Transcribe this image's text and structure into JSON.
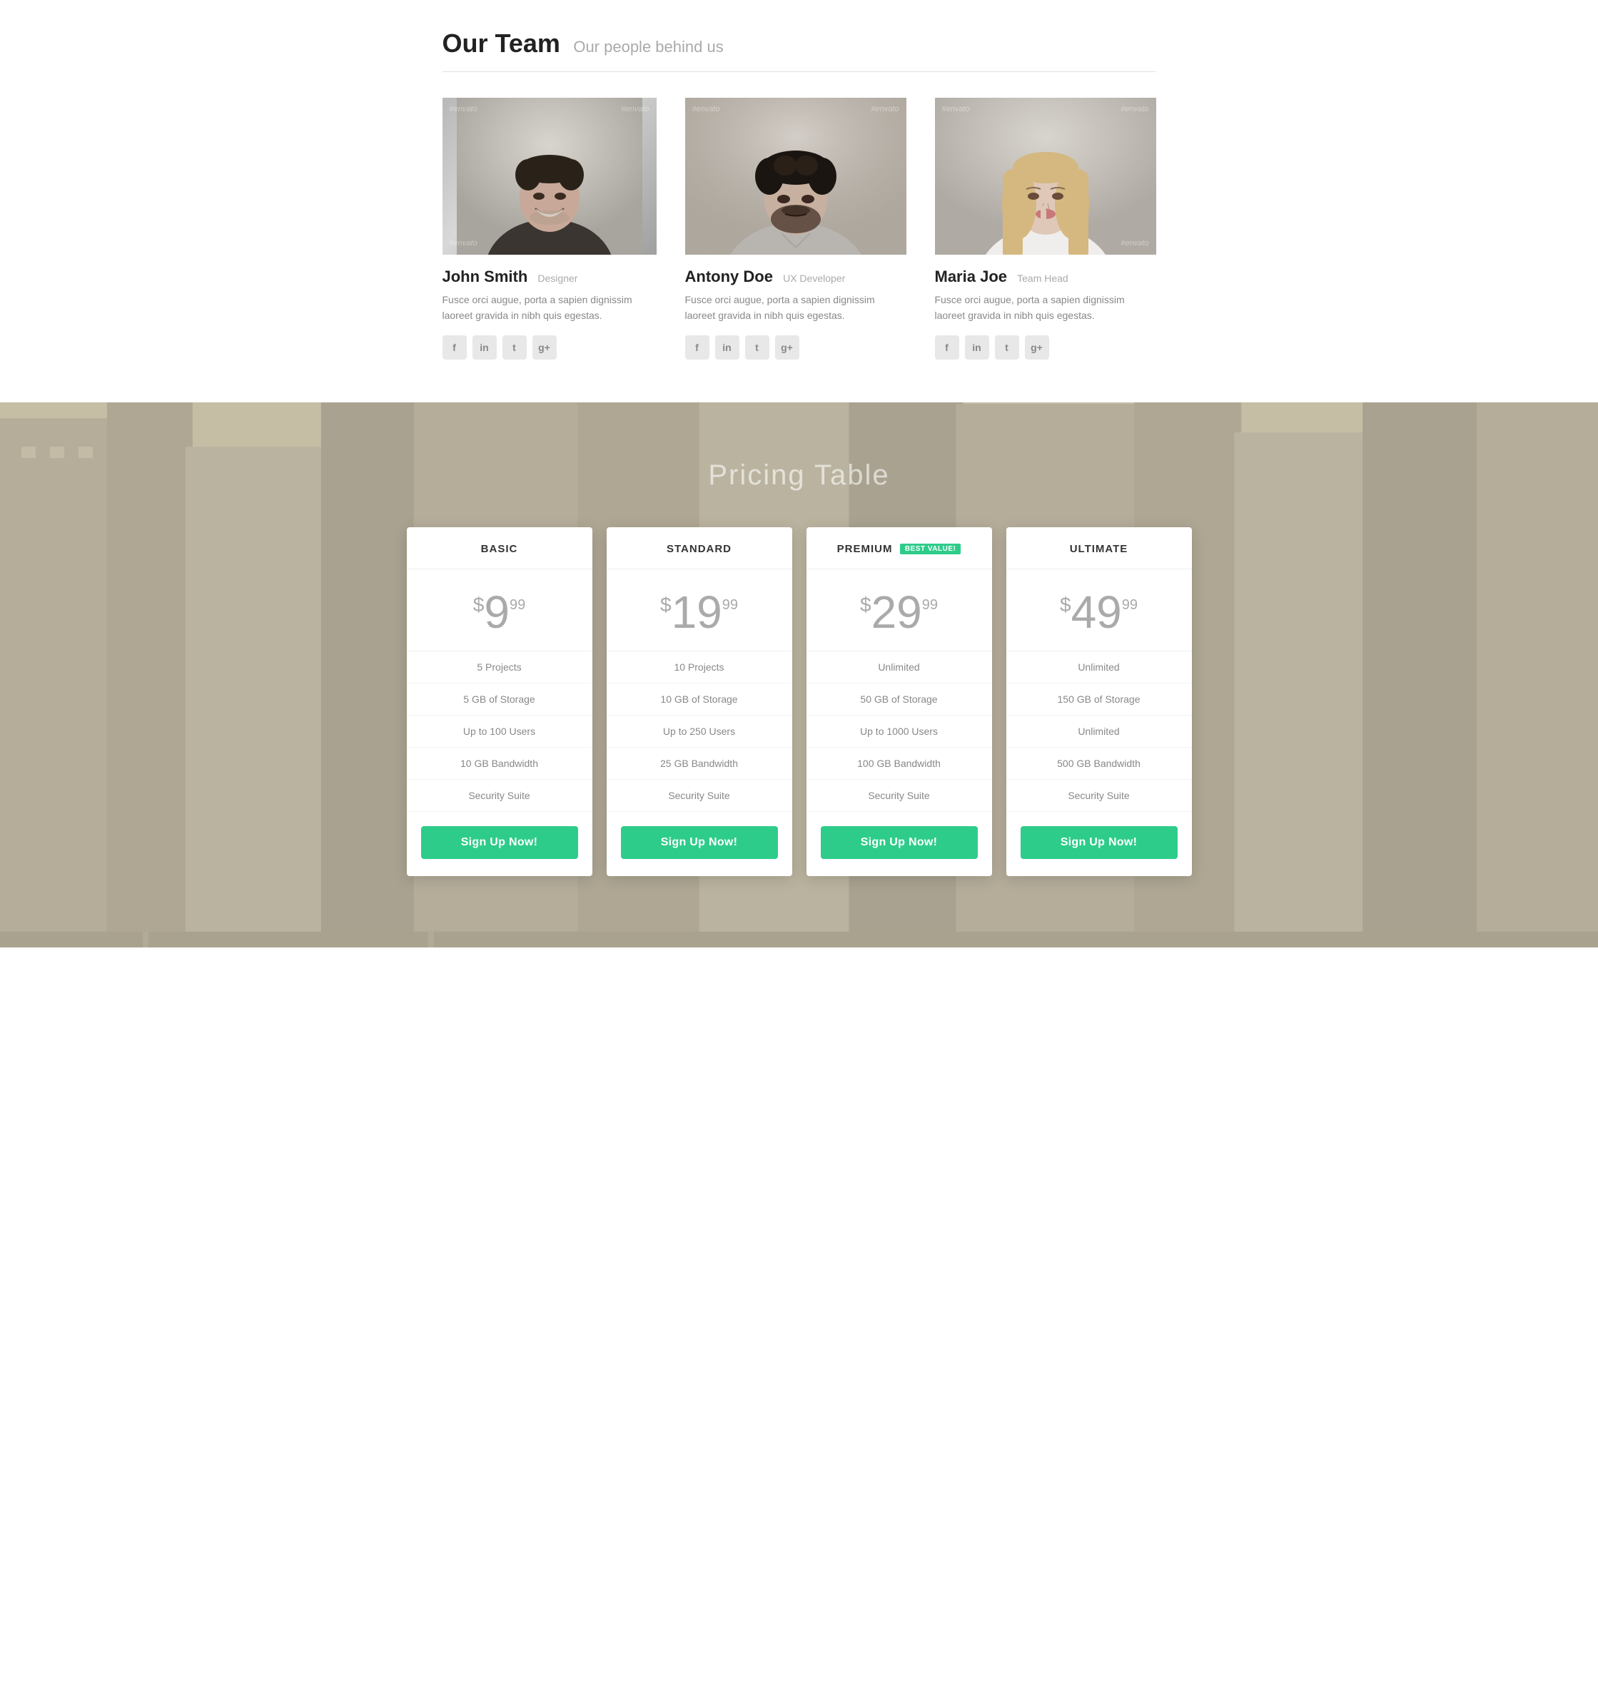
{
  "team": {
    "heading": "Our Team",
    "subheading": "Our people behind us",
    "members": [
      {
        "name": "John Smith",
        "role": "Designer",
        "bio": "Fusce orci augue, porta a sapien dignissim laoreet gravida in nibh quis egestas.",
        "socials": [
          "f",
          "in",
          "t",
          "g+"
        ]
      },
      {
        "name": "Antony Doe",
        "role": "UX Developer",
        "bio": "Fusce orci augue, porta a sapien dignissim laoreet gravida in nibh quis egestas.",
        "socials": [
          "f",
          "in",
          "t",
          "g+"
        ]
      },
      {
        "name": "Maria Joe",
        "role": "Team Head",
        "bio": "Fusce orci augue, porta a sapien dignissim laoreet gravida in nibh quis egestas.",
        "socials": [
          "f",
          "in",
          "t",
          "g+"
        ]
      }
    ]
  },
  "pricing": {
    "title": "Pricing Table",
    "plans": [
      {
        "name": "BASIC",
        "badge": null,
        "price_dollar": "$",
        "price_amount": "9",
        "price_cents": "99",
        "features": [
          "5 Projects",
          "5 GB of Storage",
          "Up to 100 Users",
          "10 GB Bandwidth",
          "Security Suite"
        ],
        "cta": "Sign Up Now!"
      },
      {
        "name": "STANDARD",
        "badge": null,
        "price_dollar": "$",
        "price_amount": "19",
        "price_cents": "99",
        "features": [
          "10 Projects",
          "10 GB of Storage",
          "Up to 250 Users",
          "25 GB Bandwidth",
          "Security Suite"
        ],
        "cta": "Sign Up Now!"
      },
      {
        "name": "PREMIUM",
        "badge": "BEST VALUE!",
        "price_dollar": "$",
        "price_amount": "29",
        "price_cents": "99",
        "features": [
          "Unlimited",
          "50 GB of Storage",
          "Up to 1000 Users",
          "100 GB Bandwidth",
          "Security Suite"
        ],
        "cta": "Sign Up Now!"
      },
      {
        "name": "ULTIMATE",
        "badge": null,
        "price_dollar": "$",
        "price_amount": "49",
        "price_cents": "99",
        "features": [
          "Unlimited",
          "150 GB of Storage",
          "Unlimited",
          "500 GB Bandwidth",
          "Security Suite"
        ],
        "cta": "Sign Up Now!"
      }
    ]
  },
  "watermark": "#envato",
  "accent_color": "#2ecc8a",
  "social_icons": {
    "facebook": "f",
    "linkedin": "in",
    "twitter": "t",
    "google": "g+"
  }
}
